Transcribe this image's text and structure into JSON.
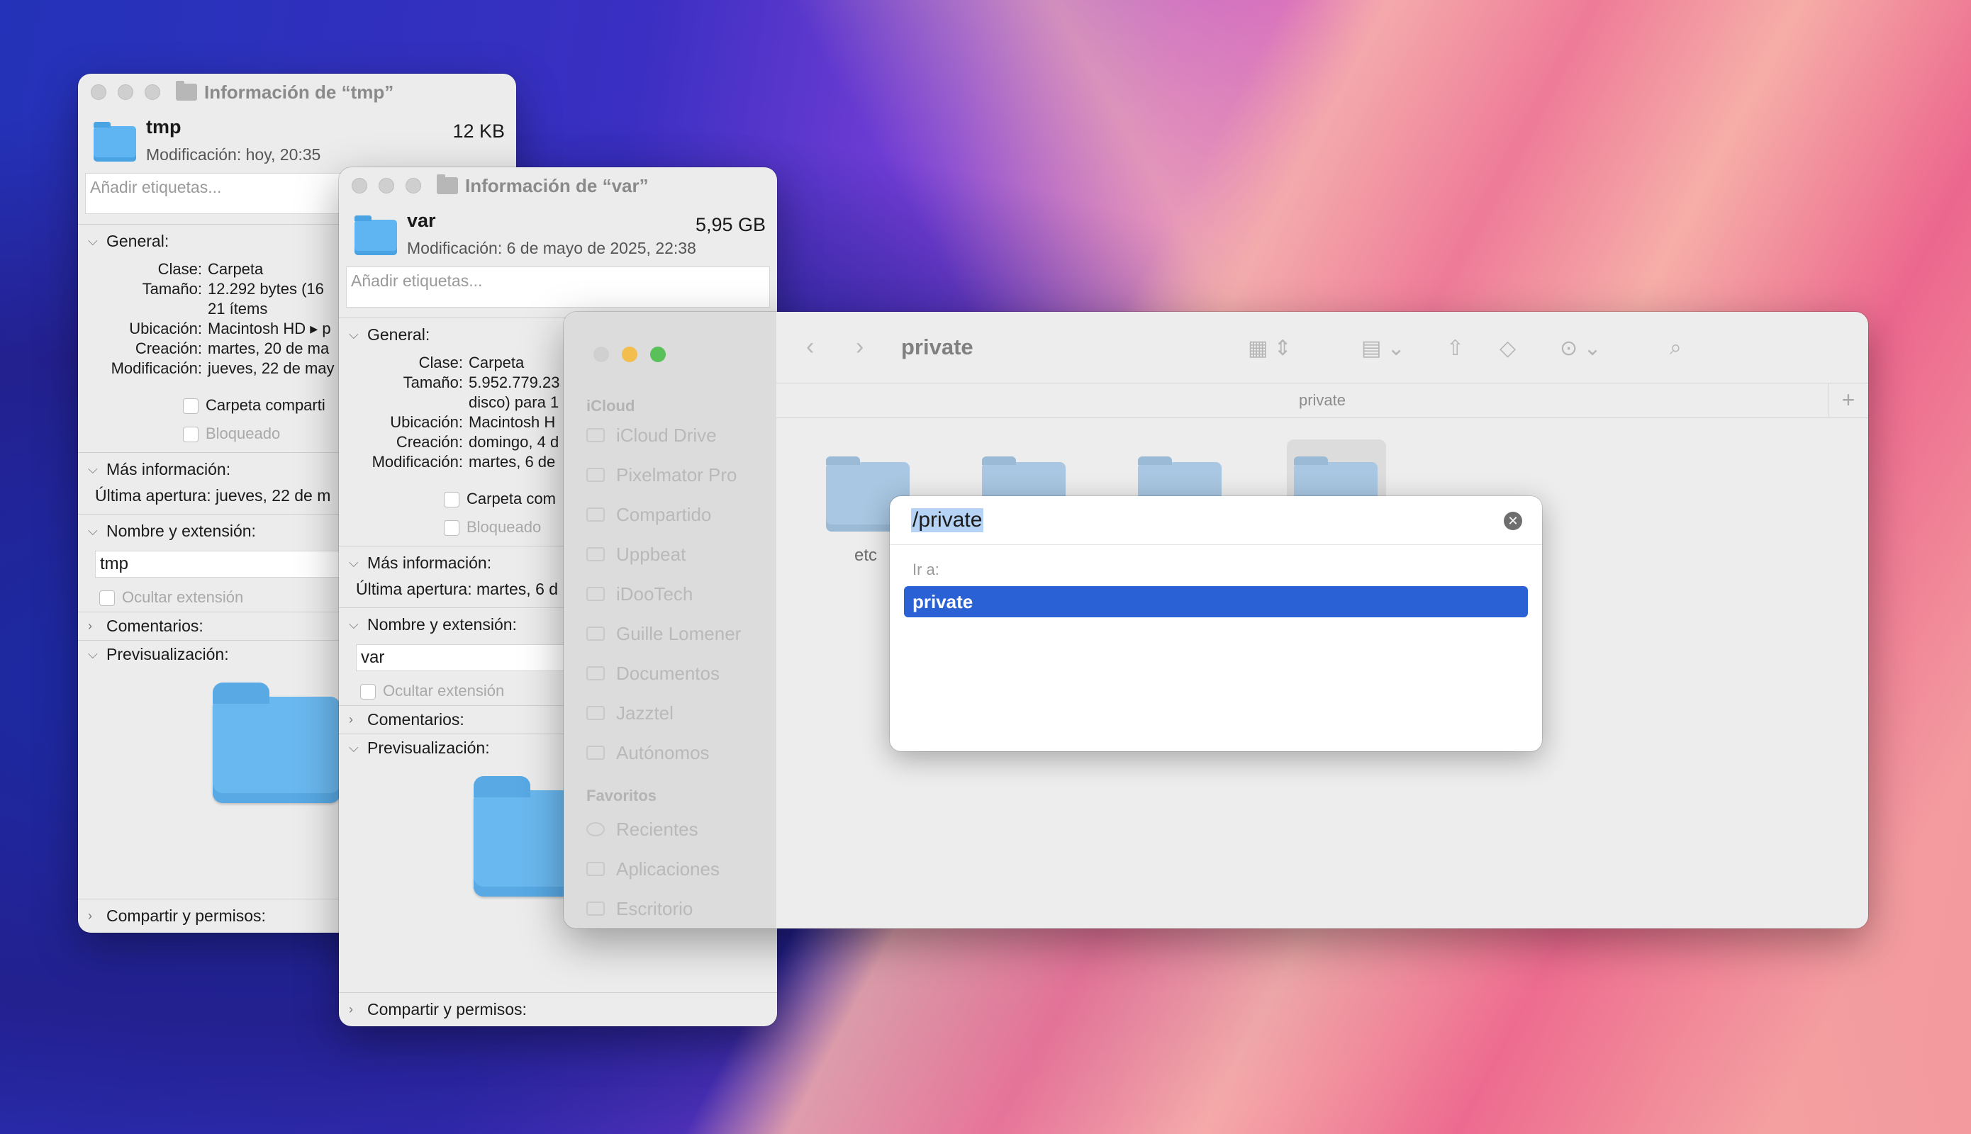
{
  "tmp_window": {
    "title": "Información de “tmp”",
    "name": "tmp",
    "size": "12 KB",
    "modified": "Modificación: hoy, 20:35",
    "tags_placeholder": "Añadir etiquetas...",
    "general": "General:",
    "rows": [
      {
        "label": "Clase:",
        "value": "Carpeta"
      },
      {
        "label": "Tamaño:",
        "value": "12.292 bytes (16"
      },
      {
        "label": "",
        "value": "21 ítems"
      },
      {
        "label": "Ubicación:",
        "value": "Macintosh HD ▸ p"
      },
      {
        "label": "Creación:",
        "value": "martes, 20 de ma"
      },
      {
        "label": "Modificación:",
        "value": "jueves, 22 de may"
      }
    ],
    "shared_folder": "Carpeta comparti",
    "locked": "Bloqueado",
    "more_info": "Más información:",
    "last_opened": "Última apertura: jueves, 22 de m",
    "name_ext": "Nombre y extensión:",
    "name_value": "tmp",
    "hide_ext": "Ocultar extensión",
    "comments": "Comentarios:",
    "preview": "Previsualización:",
    "sharing": "Compartir y permisos:"
  },
  "var_window": {
    "title": "Información de “var”",
    "name": "var",
    "size": "5,95 GB",
    "modified": "Modificación: 6 de mayo de 2025, 22:38",
    "tags_placeholder": "Añadir etiquetas...",
    "general": "General:",
    "rows": [
      {
        "label": "Clase:",
        "value": "Carpeta"
      },
      {
        "label": "Tamaño:",
        "value": "5.952.779.23"
      },
      {
        "label": "",
        "value": "disco) para 1"
      },
      {
        "label": "Ubicación:",
        "value": "Macintosh H"
      },
      {
        "label": "Creación:",
        "value": "domingo, 4 d"
      },
      {
        "label": "Modificación:",
        "value": "martes, 6 de"
      }
    ],
    "shared_folder": "Carpeta com",
    "locked": "Bloqueado",
    "more_info": "Más información:",
    "last_opened": "Última apertura: martes, 6 d",
    "name_ext": "Nombre y extensión:",
    "name_placeholder": "var",
    "hide_ext": "Ocultar extensión",
    "comments": "Comentarios:",
    "preview": "Previsualización:",
    "sharing": "Compartir y permisos:"
  },
  "finder": {
    "title": "private",
    "path": "private",
    "sidebar": {
      "icloud_header": "iCloud",
      "icloud_items": [
        "iCloud Drive",
        "Pixelmator Pro",
        "Compartido",
        "Uppbeat",
        "iDooTech",
        "Guille Lomener",
        "Documentos",
        "Jazztel",
        "Autónomos"
      ],
      "favorites_header": "Favoritos",
      "favorite_items": [
        "Recientes",
        "Aplicaciones",
        "Escritorio"
      ]
    },
    "folders": [
      "etc",
      "",
      "",
      ""
    ],
    "goto": {
      "input_value": "/private",
      "label": "Ir a:",
      "result": "private"
    }
  }
}
